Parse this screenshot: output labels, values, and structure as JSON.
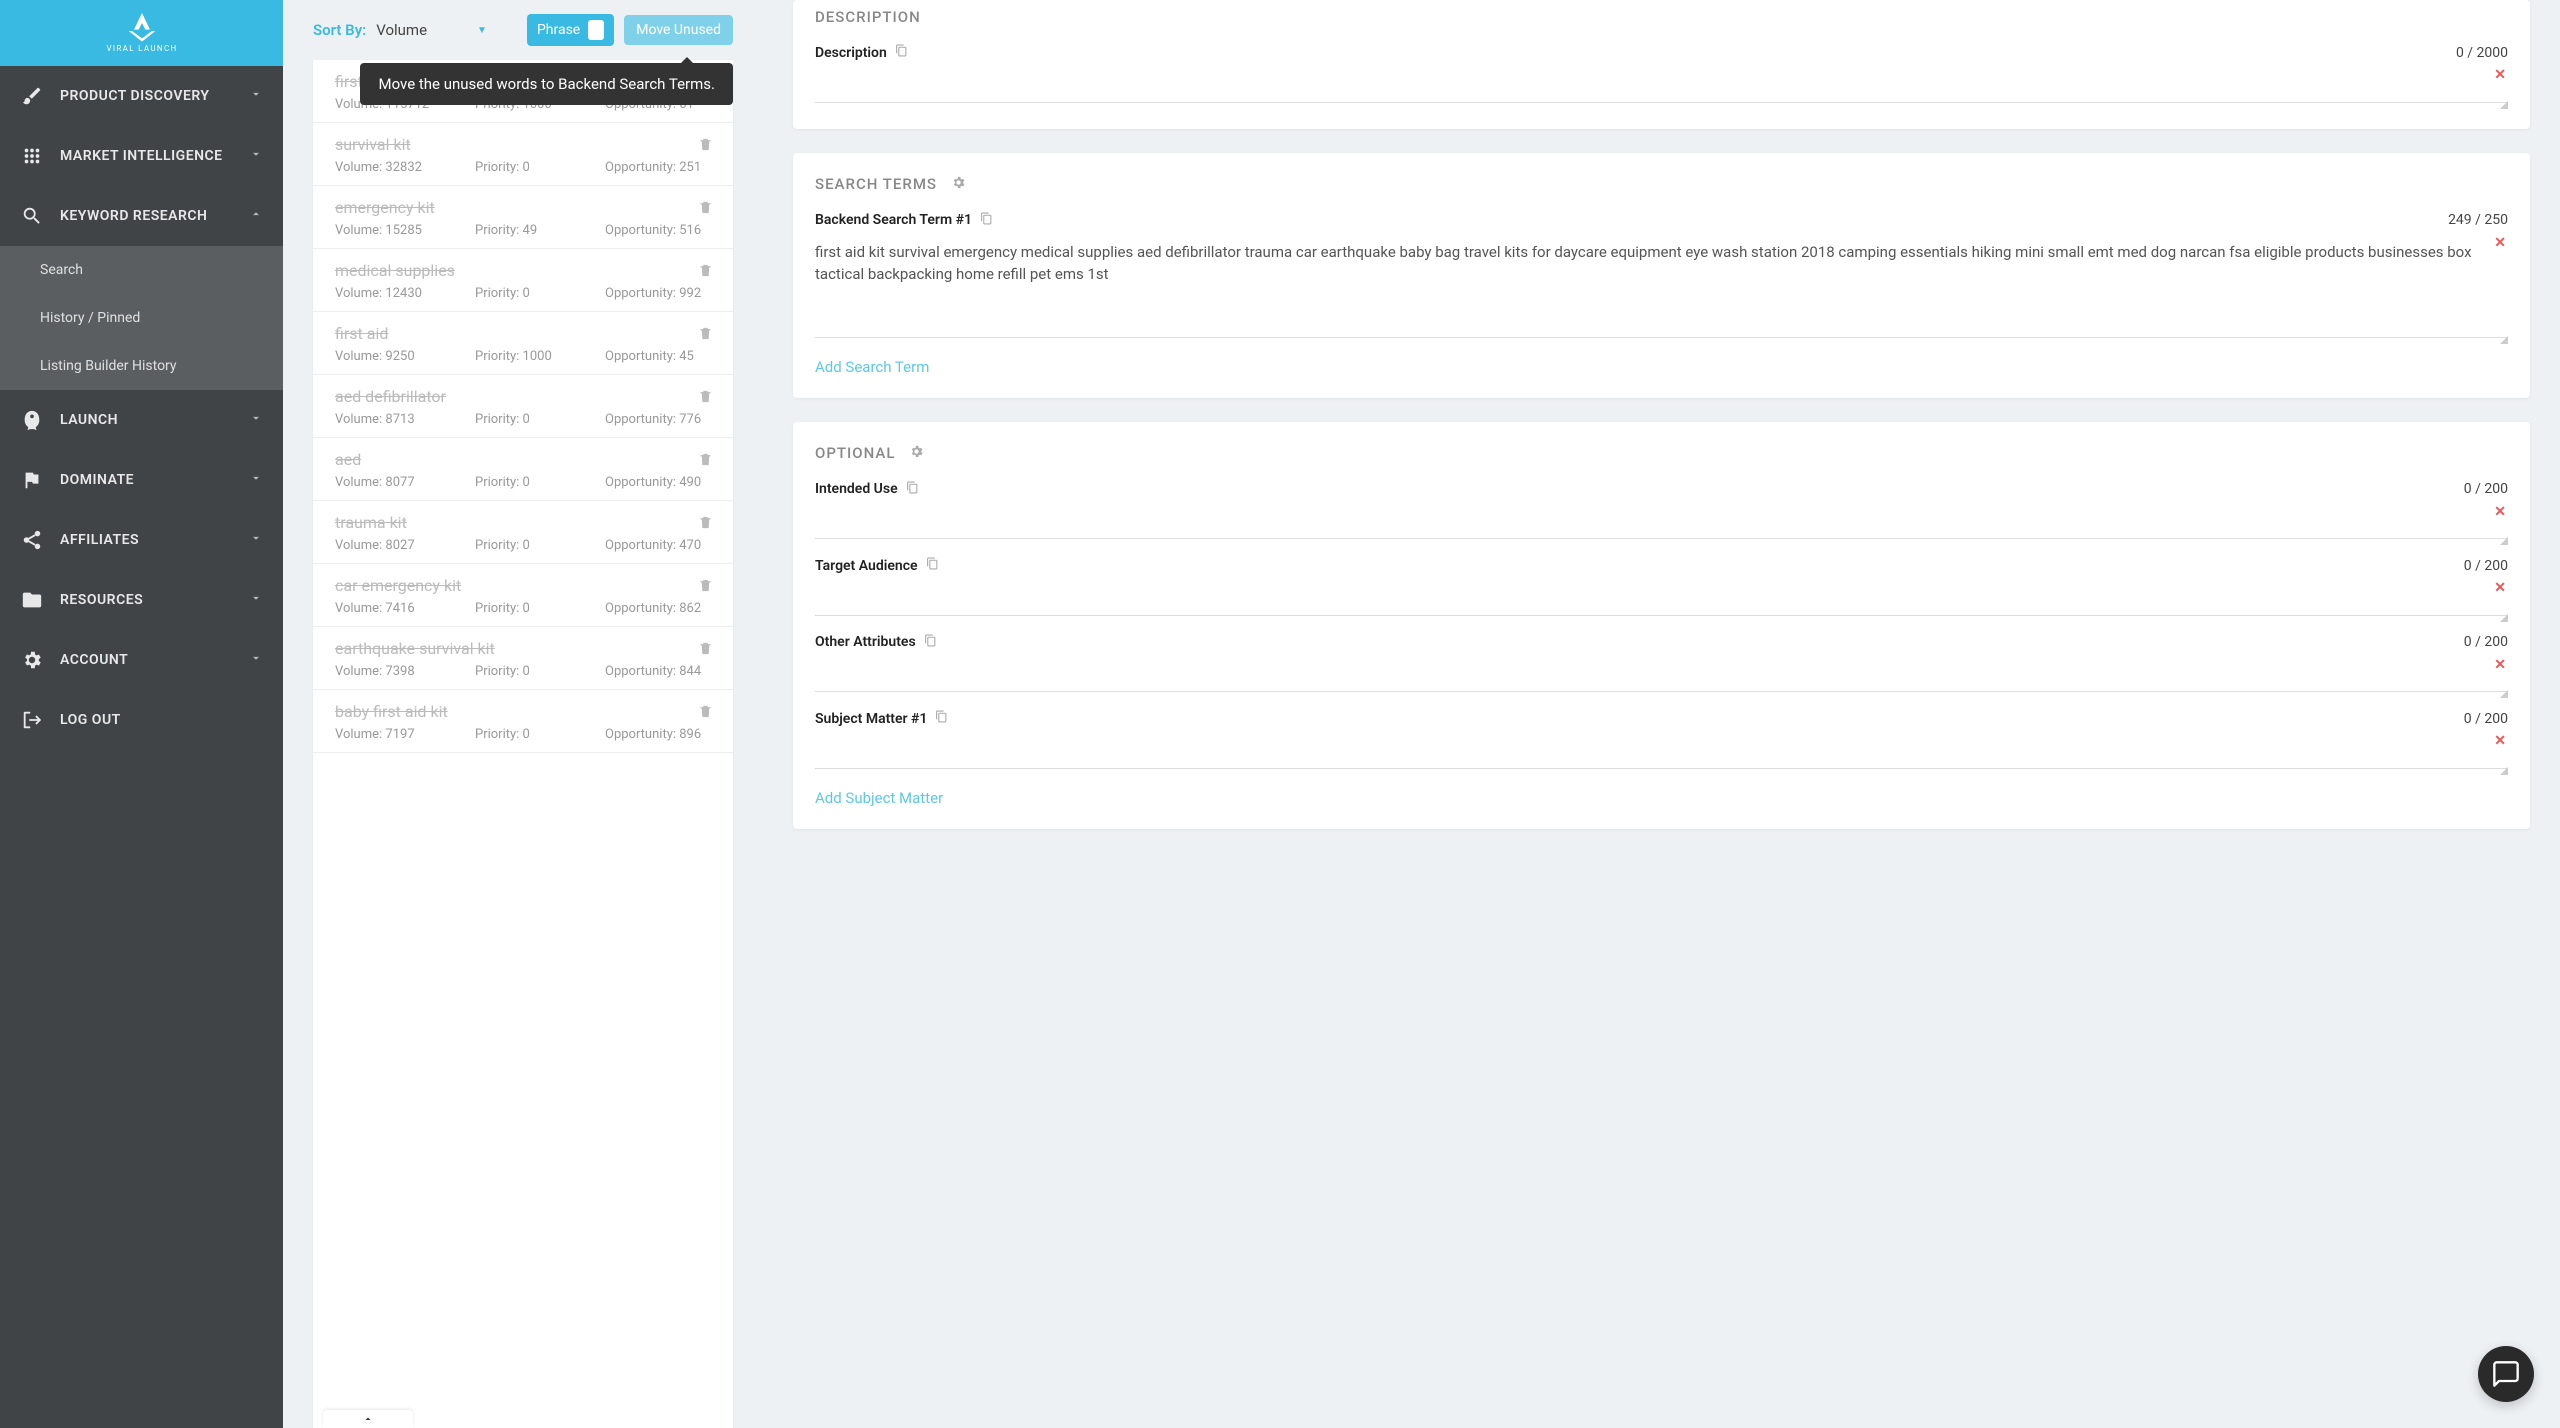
{
  "brand": "VIRAL LAUNCH",
  "nav": [
    {
      "label": "PRODUCT DISCOVERY",
      "icon": "brush"
    },
    {
      "label": "MARKET INTELLIGENCE",
      "icon": "dots"
    },
    {
      "label": "KEYWORD RESEARCH",
      "icon": "magnify",
      "expanded": true,
      "sub": [
        {
          "label": "Search"
        },
        {
          "label": "History / Pinned"
        },
        {
          "label": "Listing Builder History"
        }
      ]
    },
    {
      "label": "LAUNCH",
      "icon": "rocket"
    },
    {
      "label": "DOMINATE",
      "icon": "flag"
    },
    {
      "label": "AFFILIATES",
      "icon": "share"
    },
    {
      "label": "RESOURCES",
      "icon": "folder"
    },
    {
      "label": "ACCOUNT",
      "icon": "gear"
    },
    {
      "label": "LOG OUT",
      "icon": "exit"
    }
  ],
  "sort": {
    "label": "Sort By:",
    "value": "Volume"
  },
  "phrase_toggle": "Phrase",
  "move_unused": "Move Unused",
  "tooltip": "Move the unused words to Backend Search Terms.",
  "vol_prefix": "Volume: ",
  "pri_prefix": "Priority: ",
  "opp_prefix": "Opportunity: ",
  "keywords": [
    {
      "term": "first aid kit",
      "volume": "115712",
      "priority": "1000",
      "opportunity": "61"
    },
    {
      "term": "survival kit",
      "volume": "32832",
      "priority": "0",
      "opportunity": "251"
    },
    {
      "term": "emergency kit",
      "volume": "15285",
      "priority": "49",
      "opportunity": "516"
    },
    {
      "term": "medical supplies",
      "volume": "12430",
      "priority": "0",
      "opportunity": "992"
    },
    {
      "term": "first aid",
      "volume": "9250",
      "priority": "1000",
      "opportunity": "45"
    },
    {
      "term": "aed defibrillator",
      "volume": "8713",
      "priority": "0",
      "opportunity": "776"
    },
    {
      "term": "aed",
      "volume": "8077",
      "priority": "0",
      "opportunity": "490"
    },
    {
      "term": "trauma kit",
      "volume": "8027",
      "priority": "0",
      "opportunity": "470"
    },
    {
      "term": "car emergency kit",
      "volume": "7416",
      "priority": "0",
      "opportunity": "862"
    },
    {
      "term": "earthquake survival kit",
      "volume": "7398",
      "priority": "0",
      "opportunity": "844"
    },
    {
      "term": "baby first aid kit",
      "volume": "7197",
      "priority": "0",
      "opportunity": "896"
    }
  ],
  "description": {
    "title": "DESCRIPTION",
    "label": "Description",
    "counter": "0 / 2000",
    "value": ""
  },
  "search_terms": {
    "title": "SEARCH TERMS",
    "label": "Backend Search Term #1",
    "counter": "249 / 250",
    "value": "first aid kit survival emergency medical supplies aed defibrillator trauma car earthquake baby bag travel kits for daycare equipment eye wash station 2018 camping essentials hiking mini small emt med dog narcan fsa eligible products businesses box tactical backpacking home refill pet ems 1st",
    "add": "Add Search Term"
  },
  "optional": {
    "title": "OPTIONAL",
    "fields": [
      {
        "label": "Intended Use",
        "counter": "0 / 200"
      },
      {
        "label": "Target Audience",
        "counter": "0 / 200"
      },
      {
        "label": "Other Attributes",
        "counter": "0 / 200"
      },
      {
        "label": "Subject Matter #1",
        "counter": "0 / 200"
      }
    ],
    "add": "Add Subject Matter"
  }
}
